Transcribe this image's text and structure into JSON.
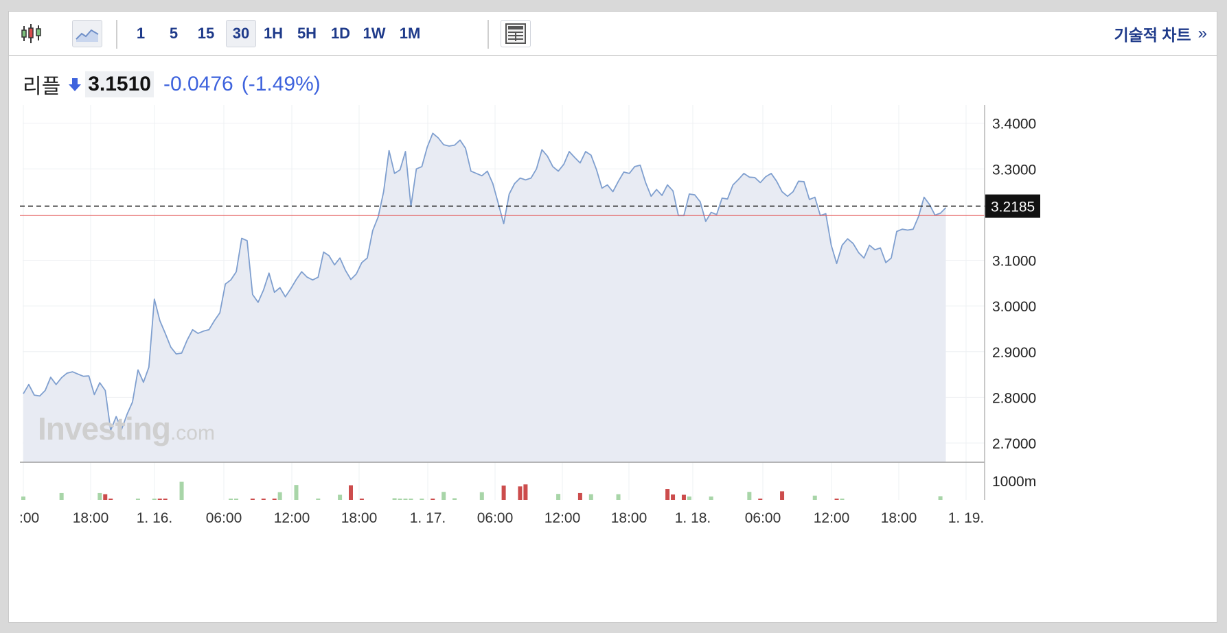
{
  "toolbar": {
    "interval_buttons": [
      "1",
      "5",
      "15",
      "30",
      "1H",
      "5H",
      "1D",
      "1W",
      "1M"
    ],
    "active_interval": "30",
    "tech_chart_label": "기술적 차트",
    "tech_chart_arrow": "»"
  },
  "quote": {
    "name": "리플",
    "price": "3.1510",
    "change": "-0.0476",
    "change_pct": "(-1.49%)"
  },
  "watermark": {
    "brand": "Investing",
    "suffix": ".com"
  },
  "colors": {
    "line": "#7f9fcf",
    "area": "#e8ebf3",
    "down": "#3e63dd",
    "prev_close_line": "#e35b5b",
    "volume_up": "#a8d5a8",
    "volume_down": "#cc4c4c"
  },
  "chart_data": {
    "type": "area",
    "title": "",
    "xlabel": "",
    "ylabel": "",
    "x_ticks": [
      ":00",
      "18:00",
      "1. 16.",
      "06:00",
      "12:00",
      "18:00",
      "1. 17.",
      "06:00",
      "12:00",
      "18:00",
      "1. 18.",
      "06:00",
      "12:00",
      "18:00",
      "1. 19."
    ],
    "y_ticks": [
      "3.4000",
      "3.3000",
      "3.1000",
      "3.0000",
      "2.9000",
      "2.8000",
      "2.7000"
    ],
    "ylim": [
      2.658,
      3.44
    ],
    "current_price_label": "3.2185",
    "current_price": 3.2185,
    "prev_close": 3.198,
    "volume_tick_label": "1000m",
    "volume_max": 1000,
    "grid": true,
    "series": [
      {
        "values": [
          2.808,
          2.828,
          2.805,
          2.803,
          2.815,
          2.844,
          2.828,
          2.843,
          2.853,
          2.856,
          2.851,
          2.846,
          2.847,
          2.806,
          2.832,
          2.815,
          2.728,
          2.758,
          2.73,
          2.763,
          2.79,
          2.86,
          2.833,
          2.866,
          3.015,
          2.968,
          2.94,
          2.91,
          2.895,
          2.897,
          2.925,
          2.948,
          2.94,
          2.945,
          2.948,
          2.968,
          2.985,
          3.048,
          3.057,
          3.075,
          3.148,
          3.143,
          3.025,
          3.008,
          3.035,
          3.072,
          3.03,
          3.04,
          3.02,
          3.038,
          3.058,
          3.075,
          3.063,
          3.057,
          3.063,
          3.118,
          3.11,
          3.09,
          3.105,
          3.078,
          3.058,
          3.07,
          3.095,
          3.105,
          3.165,
          3.195,
          3.25,
          3.34,
          3.29,
          3.298,
          3.338,
          3.218,
          3.3,
          3.305,
          3.348,
          3.378,
          3.368,
          3.353,
          3.35,
          3.352,
          3.363,
          3.345,
          3.295,
          3.29,
          3.285,
          3.295,
          3.268,
          3.225,
          3.18,
          3.245,
          3.268,
          3.28,
          3.276,
          3.28,
          3.3,
          3.342,
          3.328,
          3.305,
          3.295,
          3.31,
          3.338,
          3.325,
          3.313,
          3.338,
          3.33,
          3.298,
          3.258,
          3.265,
          3.25,
          3.273,
          3.293,
          3.29,
          3.305,
          3.308,
          3.27,
          3.24,
          3.255,
          3.242,
          3.265,
          3.252,
          3.198,
          3.198,
          3.245,
          3.243,
          3.228,
          3.185,
          3.205,
          3.2,
          3.236,
          3.234,
          3.265,
          3.277,
          3.29,
          3.282,
          3.281,
          3.27,
          3.283,
          3.29,
          3.273,
          3.25,
          3.24,
          3.25,
          3.273,
          3.272,
          3.233,
          3.238,
          3.198,
          3.202,
          3.133,
          3.093,
          3.133,
          3.147,
          3.137,
          3.117,
          3.105,
          3.133,
          3.123,
          3.127,
          3.095,
          3.105,
          3.163,
          3.168,
          3.166,
          3.168,
          3.196,
          3.238,
          3.222,
          3.199,
          3.203,
          3.215
        ]
      }
    ],
    "volume": [
      {
        "x": 0,
        "v": 120,
        "dir": "up"
      },
      {
        "x": 7,
        "v": 240,
        "dir": "up"
      },
      {
        "x": 14,
        "v": 240,
        "dir": "up"
      },
      {
        "x": 15,
        "v": 200,
        "dir": "down"
      },
      {
        "x": 16,
        "v": 40,
        "dir": "down"
      },
      {
        "x": 21,
        "v": 40,
        "dir": "up"
      },
      {
        "x": 24,
        "v": 40,
        "dir": "up"
      },
      {
        "x": 25,
        "v": 30,
        "dir": "down"
      },
      {
        "x": 26,
        "v": 30,
        "dir": "down"
      },
      {
        "x": 29,
        "v": 630,
        "dir": "up"
      },
      {
        "x": 38,
        "v": 30,
        "dir": "up"
      },
      {
        "x": 39,
        "v": 25,
        "dir": "up"
      },
      {
        "x": 42,
        "v": 25,
        "dir": "down"
      },
      {
        "x": 44,
        "v": 30,
        "dir": "down"
      },
      {
        "x": 46,
        "v": 30,
        "dir": "down"
      },
      {
        "x": 47,
        "v": 270,
        "dir": "up"
      },
      {
        "x": 50,
        "v": 520,
        "dir": "up"
      },
      {
        "x": 54,
        "v": 50,
        "dir": "up"
      },
      {
        "x": 58,
        "v": 180,
        "dir": "up"
      },
      {
        "x": 60,
        "v": 510,
        "dir": "down"
      },
      {
        "x": 62,
        "v": 25,
        "dir": "down"
      },
      {
        "x": 68,
        "v": 60,
        "dir": "up"
      },
      {
        "x": 69,
        "v": 25,
        "dir": "up"
      },
      {
        "x": 70,
        "v": 25,
        "dir": "up"
      },
      {
        "x": 71,
        "v": 25,
        "dir": "up"
      },
      {
        "x": 73,
        "v": 30,
        "dir": "up"
      },
      {
        "x": 75,
        "v": 40,
        "dir": "down"
      },
      {
        "x": 77,
        "v": 280,
        "dir": "up"
      },
      {
        "x": 79,
        "v": 60,
        "dir": "up"
      },
      {
        "x": 84,
        "v": 270,
        "dir": "up"
      },
      {
        "x": 88,
        "v": 500,
        "dir": "down"
      },
      {
        "x": 91,
        "v": 470,
        "dir": "down"
      },
      {
        "x": 92,
        "v": 540,
        "dir": "down"
      },
      {
        "x": 98,
        "v": 210,
        "dir": "up"
      },
      {
        "x": 102,
        "v": 240,
        "dir": "down"
      },
      {
        "x": 104,
        "v": 200,
        "dir": "up"
      },
      {
        "x": 109,
        "v": 200,
        "dir": "up"
      },
      {
        "x": 118,
        "v": 380,
        "dir": "down"
      },
      {
        "x": 119,
        "v": 190,
        "dir": "down"
      },
      {
        "x": 121,
        "v": 180,
        "dir": "down"
      },
      {
        "x": 122,
        "v": 120,
        "dir": "up"
      },
      {
        "x": 126,
        "v": 120,
        "dir": "up"
      },
      {
        "x": 133,
        "v": 280,
        "dir": "up"
      },
      {
        "x": 135,
        "v": 25,
        "dir": "down"
      },
      {
        "x": 139,
        "v": 300,
        "dir": "down"
      },
      {
        "x": 145,
        "v": 150,
        "dir": "up"
      },
      {
        "x": 149,
        "v": 25,
        "dir": "down"
      },
      {
        "x": 150,
        "v": 25,
        "dir": "up"
      },
      {
        "x": 168,
        "v": 130,
        "dir": "up"
      }
    ]
  }
}
